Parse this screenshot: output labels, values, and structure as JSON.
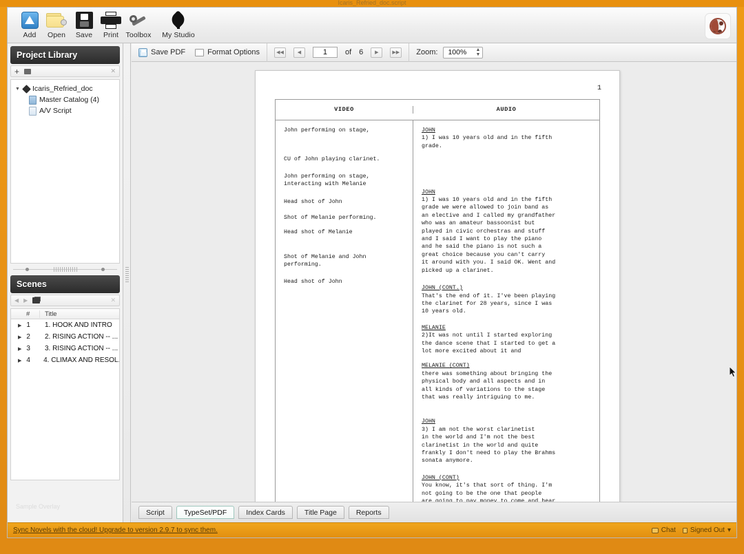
{
  "window": {
    "title": "Icaris_Refried_doc.script"
  },
  "toolbar": {
    "items": [
      {
        "label": "Add",
        "icon": "add-icon"
      },
      {
        "label": "Open",
        "icon": "folder-open-icon"
      },
      {
        "label": "Save",
        "icon": "floppy-save-icon"
      },
      {
        "label": "Print",
        "icon": "printer-icon"
      },
      {
        "label": "Toolbox",
        "icon": "wrench-icon"
      },
      {
        "label": "My Studio",
        "icon": "spade-icon"
      }
    ],
    "logo_icon": "app-logo-icon"
  },
  "sidebar": {
    "library": {
      "title": "Project Library",
      "toolbar": {
        "add_icon": "plus-icon",
        "folder_icon": "folder-icon",
        "close_icon": "x-icon"
      },
      "tree": [
        {
          "label": "Icaris_Refried_doc",
          "icon": "spade-icon",
          "depth": 0,
          "twisty": "▼"
        },
        {
          "label": "Master Catalog (4)",
          "icon": "document-icon",
          "depth": 1,
          "twisty": ""
        },
        {
          "label": "A/V Script",
          "icon": "document-icon",
          "depth": 1,
          "twisty": ""
        }
      ]
    },
    "scenes": {
      "title": "Scenes",
      "toolbar": {
        "back_icon": "left-arrow-icon",
        "forward_icon": "right-arrow-icon",
        "cards_icon": "cards-icon",
        "close_icon": "x-icon"
      },
      "columns": [
        "#",
        "Title"
      ],
      "rows": [
        {
          "num": "1",
          "title": "1. HOOK AND INTRO"
        },
        {
          "num": "2",
          "title": "2. RISING ACTION -- ..."
        },
        {
          "num": "3",
          "title": "3. RISING ACTION -- ..."
        },
        {
          "num": "4",
          "title": "4. CLIMAX AND RESOL..."
        }
      ]
    },
    "watermark": "Sample Overlay"
  },
  "pdf_toolbar": {
    "save_pdf_label": "Save PDF",
    "format_options_label": "Format Options",
    "first_page_icon": "first-page-icon",
    "prev_page_icon": "prev-page-icon",
    "next_page_icon": "next-page-icon",
    "last_page_icon": "last-page-icon",
    "page_value": "1",
    "of_label": "of",
    "page_count": "6",
    "zoom_label": "Zoom:",
    "zoom_value": "100%"
  },
  "document": {
    "page_number": "1",
    "columns": {
      "video": "VIDEO",
      "audio": "AUDIO"
    },
    "rows": [
      {
        "video": "John performing on stage,",
        "audio_speaker": "JOHN",
        "audio_text": "1) I was 10 years old and in the fifth\ngrade."
      },
      {
        "video": "CU of John playing clarinet.",
        "audio_speaker": "",
        "audio_text": ""
      },
      {
        "video": "John performing on stage,\ninteracting with Melanie",
        "audio_speaker": "JOHN",
        "audio_text": "1) I was 10 years old and in the fifth\ngrade we were allowed to join band as\nan elective and I called my grandfather\nwho was an amateur bassoonist but\nplayed in civic orchestras and stuff\nand I said I want to play the piano\nand he said the piano is not such a\ngreat choice because you can't carry\nit around with you. I said OK. Went and\npicked up a clarinet."
      },
      {
        "video": "Head shot of John",
        "audio_speaker": "JOHN (CONT.)",
        "audio_text": "That's the end of it. I've been playing\nthe clarinet for 28 years, since I was\n10 years old."
      },
      {
        "video": "Shot of Melanie performing.",
        "audio_speaker": "MELANIE",
        "audio_text": "2)It was not until I started exploring\nthe dance scene that I started to get a\nlot more excited about it and"
      },
      {
        "video": "Head shot of Melanie",
        "audio_speaker": "MELANIE (CONT)",
        "audio_text": "there was something about bringing the\nphysical body and all aspects and in\nall kinds of variations to the stage\nthat was really intriguing to me."
      },
      {
        "video": "Shot of Melanie and John\nperforming.",
        "audio_speaker": "JOHN",
        "audio_text": "3) I am not the worst clarinetist\nin the world and I'm not the best\nclarinetist in the world and quite\nfrankly I don't need to play the Brahms\nsonata anymore."
      },
      {
        "video": "Head shot of John",
        "audio_speaker": "JOHN (CONT)",
        "audio_text": "You know, it's that sort of thing. I'm\nnot going to be the one that people\nare going to pay money to come and hear\nme play a Brahms sonata or Beethoven\nsonata necessarily."
      }
    ]
  },
  "tabs": [
    {
      "label": "Script",
      "active": false
    },
    {
      "label": "TypeSet/PDF",
      "active": true
    },
    {
      "label": "Index Cards",
      "active": false
    },
    {
      "label": "Title Page",
      "active": false
    },
    {
      "label": "Reports",
      "active": false
    }
  ],
  "statusbar": {
    "message": "Sync Novels with the cloud! Upgrade to version 2.9.7 to sync them.",
    "chat_label": "Chat",
    "account_label": "Signed Out",
    "account_caret": "▾"
  },
  "colors": {
    "accent": "#e8900f",
    "panel_header": "#2b2b2b",
    "active_tab": "#f4faf8"
  }
}
